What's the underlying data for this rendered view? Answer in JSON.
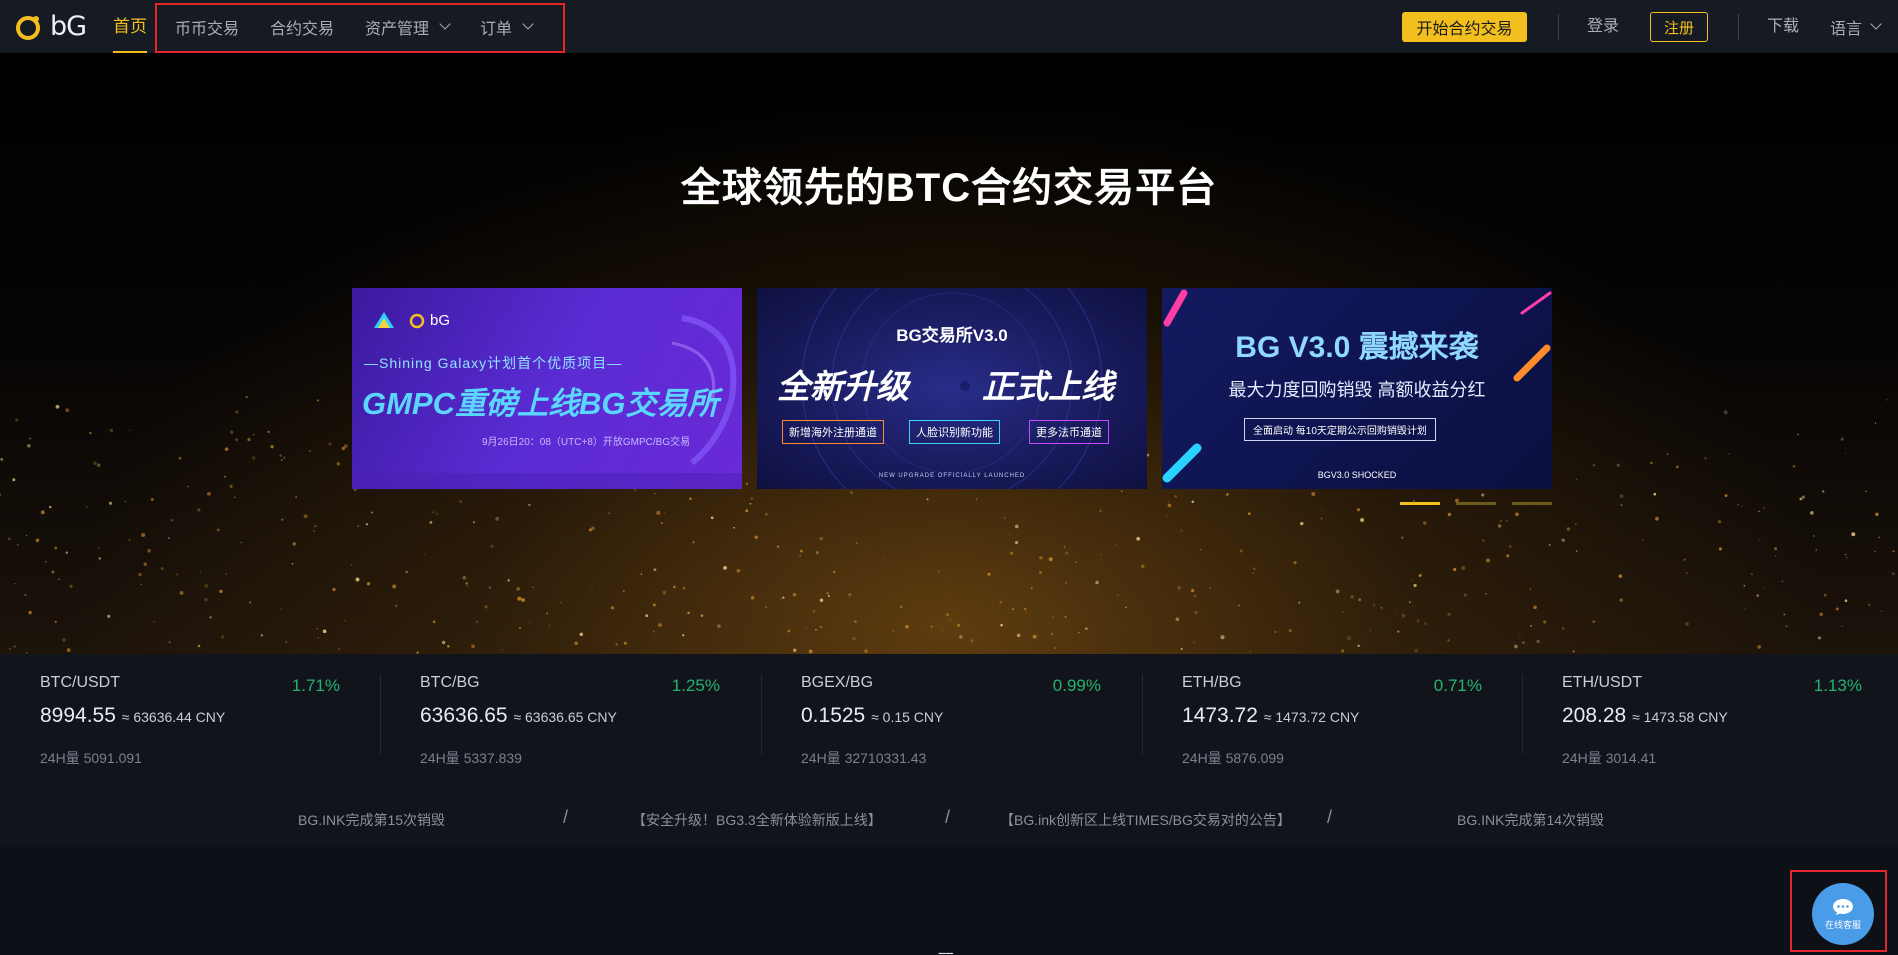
{
  "header": {
    "logo_text": "bG",
    "nav_home": "首页",
    "nav_items": [
      "币币交易",
      "合约交易",
      "资产管理",
      "订单"
    ],
    "start_button": "开始合约交易",
    "login": "登录",
    "register": "注册",
    "download": "下载",
    "language": "语言"
  },
  "hero": {
    "title": "全球领先的BTC合约交易平台",
    "banners": [
      {
        "logo_text": "bG",
        "line1": "—Shining Galaxy计划首个优质项目—",
        "headline": "GMPC重磅上线BG交易所",
        "note": "9月26日20：08（UTC+8）开放GMPC/BG交易"
      },
      {
        "title": "BG交易所V3.0",
        "headline_left": "全新升级",
        "headline_right": "正式上线",
        "tags": [
          "新增海外注册通道",
          "人脸识别新功能",
          "更多法币通道"
        ],
        "footer": "NEW UPGRADE OFFICIALLY LAUNCHED"
      },
      {
        "title": "BG V3.0 震撼来袭",
        "subtitle": "最大力度回购销毁  高额收益分红",
        "tag": "全面启动  每10天定期公示回购销毁计划",
        "footer": "BGV3.0 SHOCKED"
      }
    ],
    "active_slide": 0
  },
  "markets": [
    {
      "pair": "BTC/USDT",
      "change": "1.71%",
      "price": "8994.55",
      "cny": "≈ 63636.44 CNY",
      "volume": "24H量 5091.091"
    },
    {
      "pair": "BTC/BG",
      "change": "1.25%",
      "price": "63636.65",
      "cny": "≈ 63636.65 CNY",
      "volume": "24H量 5337.839"
    },
    {
      "pair": "BGEX/BG",
      "change": "0.99%",
      "price": "0.1525",
      "cny": "≈ 0.15 CNY",
      "volume": "24H量 32710331.43"
    },
    {
      "pair": "ETH/BG",
      "change": "0.71%",
      "price": "1473.72",
      "cny": "≈ 1473.72 CNY",
      "volume": "24H量 5876.099"
    },
    {
      "pair": "ETH/USDT",
      "change": "1.13%",
      "price": "208.28",
      "cny": "≈ 1473.58 CNY",
      "volume": "24H量 3014.41"
    }
  ],
  "notices": [
    "BG.INK完成第15次销毁",
    "【安全升级！BG3.3全新体验新版上线】",
    "【BG.ink创新区上线TIMES/BG交易对的公告】",
    "BG.INK完成第14次销毁"
  ],
  "notice_separator": "/",
  "footer_dash": "----",
  "support": {
    "label": "在线客服"
  },
  "colors": {
    "accent": "#f3bf1e",
    "up": "#27b26f",
    "highlight_box": "#e3262c",
    "support": "#4a9be8"
  }
}
